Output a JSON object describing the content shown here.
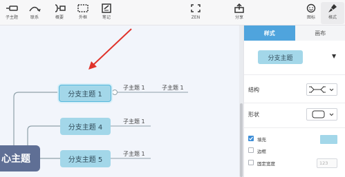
{
  "toolbar": {
    "items": [
      {
        "label": "子主题",
        "icon": "add-subtopic-icon"
      },
      {
        "label": "联系",
        "icon": "relationship-icon"
      },
      {
        "label": "概要",
        "icon": "summary-icon"
      },
      {
        "label": "外框",
        "icon": "boundary-icon"
      },
      {
        "label": "笔记",
        "icon": "note-icon"
      },
      {
        "label": "ZEN",
        "icon": "zen-icon"
      },
      {
        "label": "分享",
        "icon": "share-icon"
      },
      {
        "label": "图标",
        "icon": "emoji-icon"
      },
      {
        "label": "格式",
        "icon": "format-brush-icon"
      }
    ]
  },
  "canvas": {
    "central_topic": "心主题",
    "branches": [
      {
        "label": "分支主题 1",
        "selected": true,
        "subtopics": [
          "子主题 1",
          "子主题 1"
        ]
      },
      {
        "label": "分支主题 4",
        "selected": false,
        "subtopics": [
          "子主题 1"
        ]
      },
      {
        "label": "分支主题 5",
        "selected": false,
        "subtopics": [
          "子主题 1"
        ]
      }
    ],
    "annotation_arrow_color": "#e0332b"
  },
  "panel": {
    "tabs": [
      "样式",
      "画布"
    ],
    "active_tab": "样式",
    "style_preview": "分支主题",
    "structure_label": "结构",
    "shape_label": "形状",
    "fill_label": "填充",
    "fill_checked": true,
    "fill_color": "#a3d7e9",
    "border_label": "边框",
    "border_checked": false,
    "fixed_width_label": "固定宽度",
    "fixed_width_checked": false,
    "fixed_width_placeholder": "123"
  },
  "colors": {
    "branch_fill": "#a3d7e9",
    "central_fill": "#5f6f95",
    "accent": "#4fa4dd",
    "line": "#8ea0a8"
  }
}
